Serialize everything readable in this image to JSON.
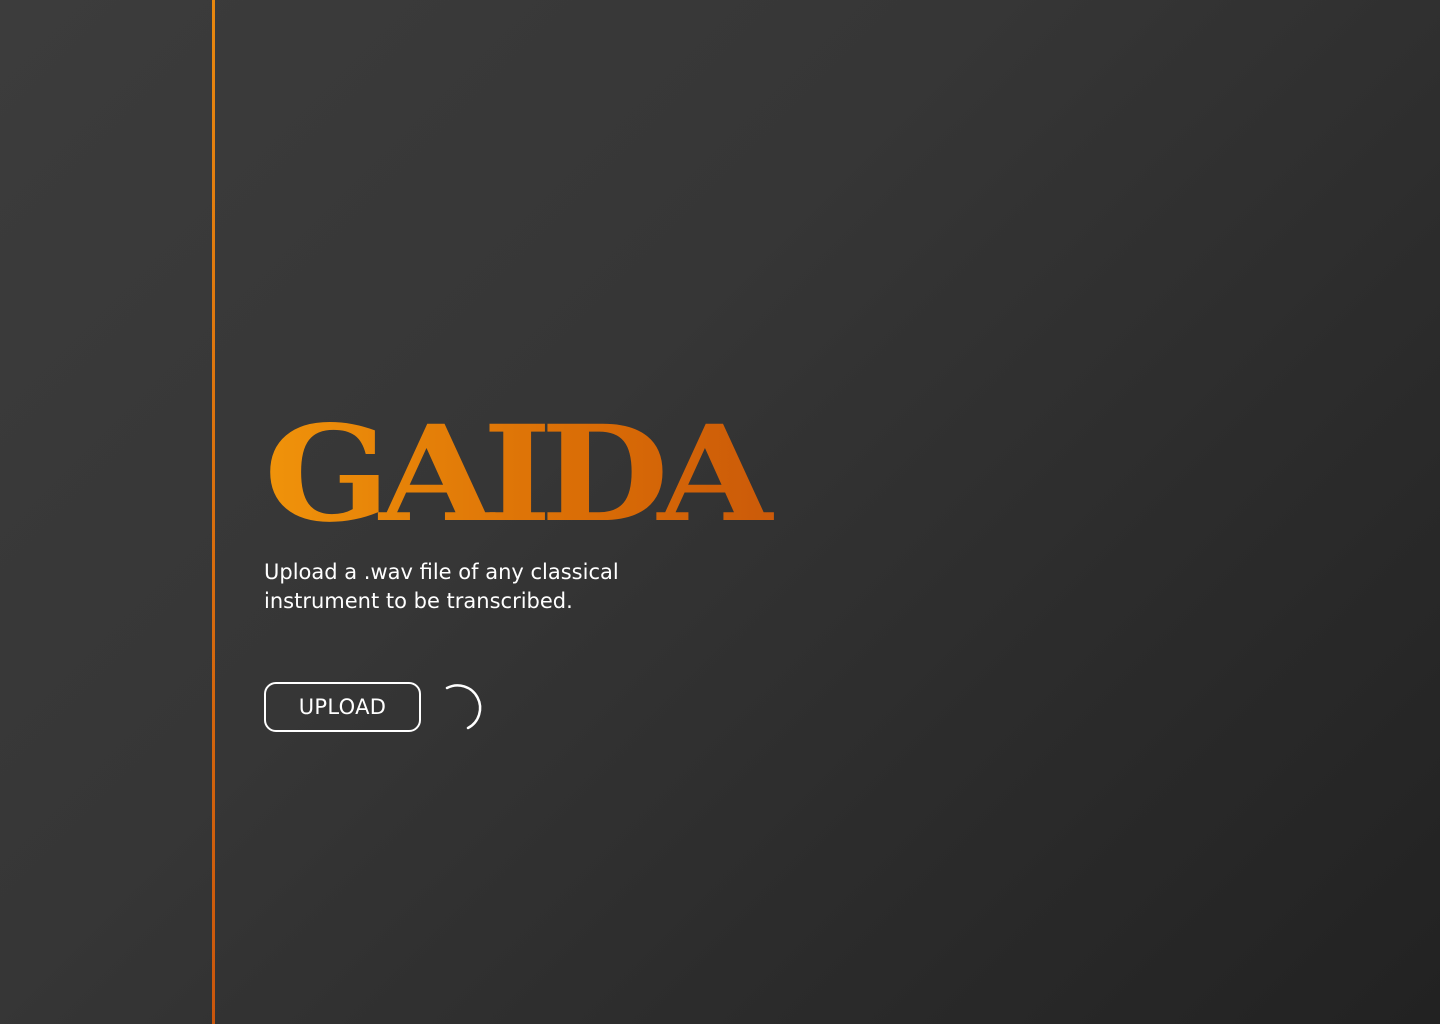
{
  "app": {
    "title": "GAIDA",
    "subtitle": "Upload a .wav file of any classical instrument to be transcribed."
  },
  "actions": {
    "upload_label": "UPLOAD",
    "loading_icon": "loading-spinner-icon"
  },
  "colors": {
    "accent_start": "#f0930a",
    "accent_end": "#c24f0c",
    "background": "#333333",
    "text": "#ffffff"
  }
}
